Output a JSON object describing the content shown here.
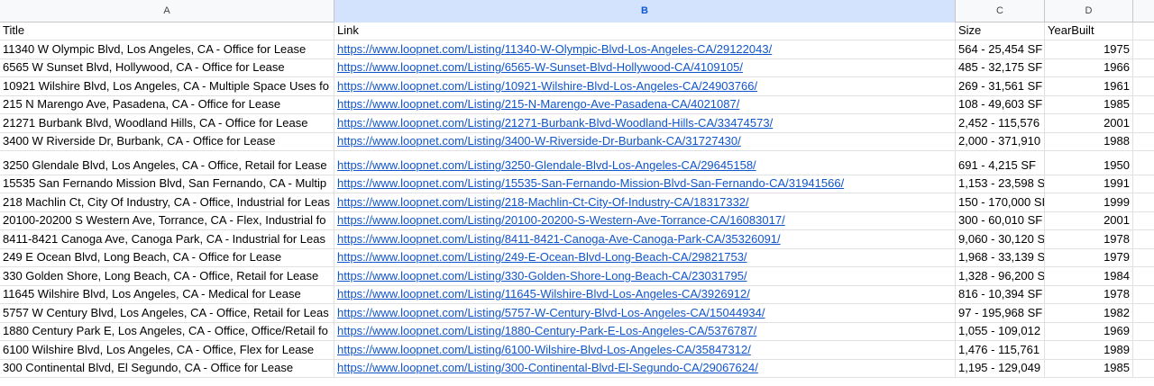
{
  "columns": [
    {
      "letter": "A",
      "selected": false
    },
    {
      "letter": "B",
      "selected": true
    },
    {
      "letter": "C",
      "selected": false
    },
    {
      "letter": "D",
      "selected": false
    }
  ],
  "header": {
    "title": "Title",
    "link": "Link",
    "size": "Size",
    "year": "YearBuilt"
  },
  "rows": [
    {
      "title": "11340 W Olympic Blvd, Los Angeles, CA - Office for Lease",
      "link": "https://www.loopnet.com/Listing/11340-W-Olympic-Blvd-Los-Angeles-CA/29122043/",
      "size": "564 - 25,454 SF",
      "year": "1975"
    },
    {
      "title": "6565 W Sunset Blvd, Hollywood, CA - Office for Lease",
      "link": "https://www.loopnet.com/Listing/6565-W-Sunset-Blvd-Hollywood-CA/4109105/",
      "size": "485 - 32,175 SF",
      "year": "1966"
    },
    {
      "title": "10921 Wilshire Blvd, Los Angeles, CA - Multiple Space Uses fo",
      "link": "https://www.loopnet.com/Listing/10921-Wilshire-Blvd-Los-Angeles-CA/24903766/",
      "size": "269 - 31,561 SF",
      "year": "1961"
    },
    {
      "title": "215 N Marengo Ave, Pasadena, CA - Office for Lease",
      "link": "https://www.loopnet.com/Listing/215-N-Marengo-Ave-Pasadena-CA/4021087/",
      "size": "108 - 49,603 SF",
      "year": "1985"
    },
    {
      "title": "21271 Burbank Blvd, Woodland Hills, CA - Office for Lease",
      "link": "https://www.loopnet.com/Listing/21271-Burbank-Blvd-Woodland-Hills-CA/33474573/",
      "size": "2,452 - 115,576",
      "year": "2001"
    },
    {
      "title": "3400 W Riverside Dr, Burbank, CA - Office for Lease",
      "link": "https://www.loopnet.com/Listing/3400-W-Riverside-Dr-Burbank-CA/31727430/",
      "size": "2,000 - 371,910",
      "year": "1988"
    },
    {
      "title": "3250 Glendale Blvd, Los Angeles, CA - Office, Retail for Lease",
      "link": "https://www.loopnet.com/Listing/3250-Glendale-Blvd-Los-Angeles-CA/29645158/",
      "size": "691 - 4,215 SF",
      "year": "1950"
    },
    {
      "title": "15535 San Fernando Mission Blvd, San Fernando, CA - Multip",
      "link": "https://www.loopnet.com/Listing/15535-San-Fernando-Mission-Blvd-San-Fernando-CA/31941566/",
      "size": "1,153 - 23,598 S",
      "year": "1991"
    },
    {
      "title": "218 Machlin Ct, City Of Industry, CA - Office, Industrial for Leas",
      "link": "https://www.loopnet.com/Listing/218-Machlin-Ct-City-Of-Industry-CA/18317332/",
      "size": "150 - 170,000 SI",
      "year": "1999"
    },
    {
      "title": "20100-20200 S Western Ave, Torrance, CA - Flex, Industrial fo",
      "link": "https://www.loopnet.com/Listing/20100-20200-S-Western-Ave-Torrance-CA/16083017/",
      "size": "300 - 60,010 SF",
      "year": "2001"
    },
    {
      "title": "8411-8421 Canoga Ave, Canoga Park, CA - Industrial for Leas",
      "link": "https://www.loopnet.com/Listing/8411-8421-Canoga-Ave-Canoga-Park-CA/35326091/",
      "size": "9,060 - 30,120 S",
      "year": "1978"
    },
    {
      "title": "249 E Ocean Blvd, Long Beach, CA - Office for Lease",
      "link": "https://www.loopnet.com/Listing/249-E-Ocean-Blvd-Long-Beach-CA/29821753/",
      "size": "1,968 - 33,139 S",
      "year": "1979"
    },
    {
      "title": "330 Golden Shore, Long Beach, CA - Office, Retail for Lease",
      "link": "https://www.loopnet.com/Listing/330-Golden-Shore-Long-Beach-CA/23031795/",
      "size": "1,328 - 96,200 S",
      "year": "1984"
    },
    {
      "title": "11645 Wilshire Blvd, Los Angeles, CA - Medical for Lease",
      "link": "https://www.loopnet.com/Listing/11645-Wilshire-Blvd-Los-Angeles-CA/3926912/",
      "size": "816 - 10,394 SF",
      "year": "1978"
    },
    {
      "title": "5757 W Century Blvd, Los Angeles, CA - Office, Retail for Leas",
      "link": "https://www.loopnet.com/Listing/5757-W-Century-Blvd-Los-Angeles-CA/15044934/",
      "size": "97 - 195,968 SF",
      "year": "1982"
    },
    {
      "title": "1880 Century Park E, Los Angeles, CA - Office, Office/Retail fo",
      "link": "https://www.loopnet.com/Listing/1880-Century-Park-E-Los-Angeles-CA/5376787/",
      "size": "1,055 - 109,012",
      "year": "1969"
    },
    {
      "title": "6100 Wilshire Blvd, Los Angeles, CA - Office, Flex for Lease",
      "link": "https://www.loopnet.com/Listing/6100-Wilshire-Blvd-Los-Angeles-CA/35847312/",
      "size": "1,476 - 115,761",
      "year": "1989"
    },
    {
      "title": "300 Continental Blvd, El Segundo, CA - Office for Lease",
      "link": "https://www.loopnet.com/Listing/300-Continental-Blvd-El-Segundo-CA/29067624/",
      "size": "1,195 - 129,049",
      "year": "1985"
    }
  ]
}
